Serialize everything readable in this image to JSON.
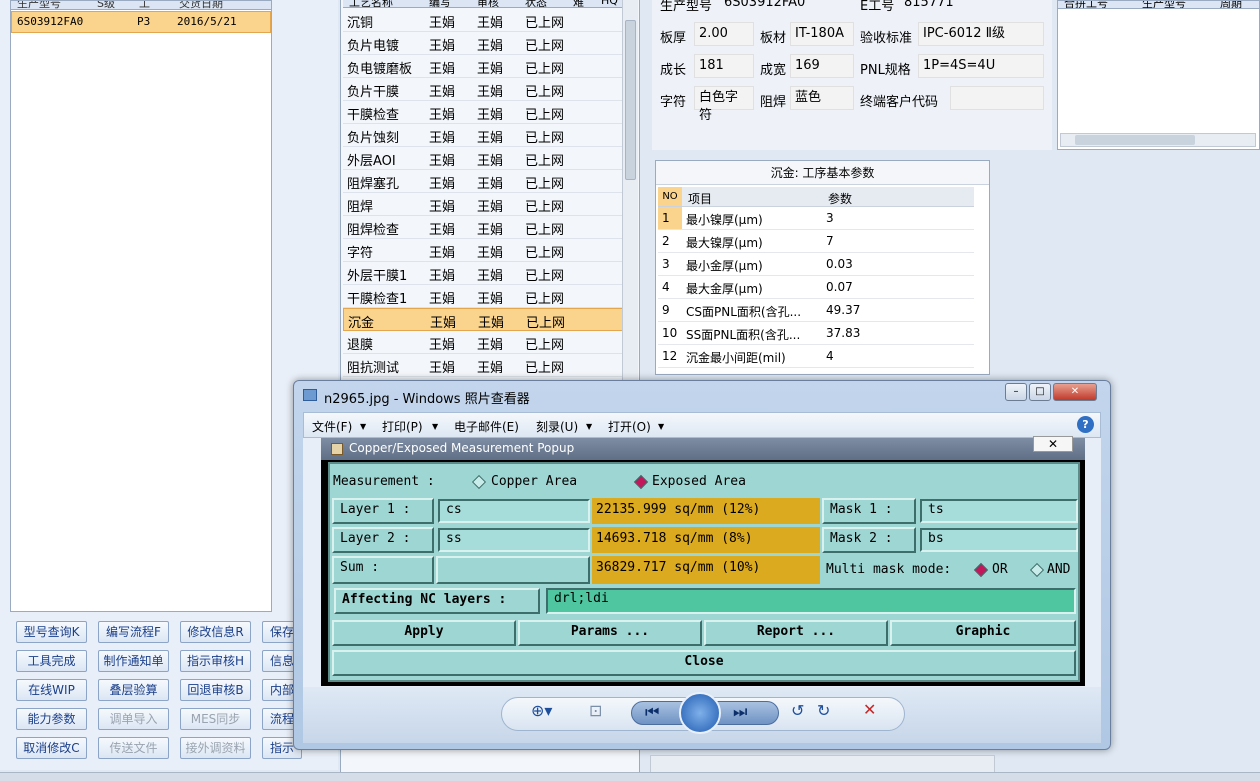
{
  "left": {
    "headers": [
      "生产型号",
      "S级",
      "工",
      "交货日期"
    ],
    "row": {
      "model": "6S03912FA0",
      "grade": "P3",
      "date": "2016/5/21"
    },
    "buttons": [
      [
        "型号查询K",
        "编写流程F",
        "修改信息R",
        "保存"
      ],
      [
        "工具完成",
        "制作通知单",
        "指示审核H",
        "信息"
      ],
      [
        "在线WIP",
        "叠层验算",
        "回退审核B",
        "内部"
      ],
      [
        "能力参数",
        "调单导入",
        "MES同步",
        "流程"
      ],
      [
        "取消修改C",
        "传送文件",
        "接外调资料",
        "指示"
      ]
    ]
  },
  "mid": {
    "headers": [
      "工艺名称",
      "编写",
      "审核",
      "状态",
      "难",
      "HQ"
    ],
    "rows": [
      {
        "name": "沉铜",
        "w": "王娟",
        "a": "王娟",
        "s": "已上网"
      },
      {
        "name": "负片电镀",
        "w": "王娟",
        "a": "王娟",
        "s": "已上网"
      },
      {
        "name": "负电镀磨板",
        "w": "王娟",
        "a": "王娟",
        "s": "已上网"
      },
      {
        "name": "负片干膜",
        "w": "王娟",
        "a": "王娟",
        "s": "已上网"
      },
      {
        "name": "干膜检查",
        "w": "王娟",
        "a": "王娟",
        "s": "已上网"
      },
      {
        "name": "负片蚀刻",
        "w": "王娟",
        "a": "王娟",
        "s": "已上网"
      },
      {
        "name": "外层AOI",
        "w": "王娟",
        "a": "王娟",
        "s": "已上网"
      },
      {
        "name": "阻焊塞孔",
        "w": "王娟",
        "a": "王娟",
        "s": "已上网"
      },
      {
        "name": "阻焊",
        "w": "王娟",
        "a": "王娟",
        "s": "已上网"
      },
      {
        "name": "阻焊检查",
        "w": "王娟",
        "a": "王娟",
        "s": "已上网"
      },
      {
        "name": "字符",
        "w": "王娟",
        "a": "王娟",
        "s": "已上网"
      },
      {
        "name": "外层干膜1",
        "w": "王娟",
        "a": "王娟",
        "s": "已上网"
      },
      {
        "name": "干膜检查1",
        "w": "王娟",
        "a": "王娟",
        "s": "已上网"
      },
      {
        "name": "沉金",
        "w": "王娟",
        "a": "王娟",
        "s": "已上网"
      },
      {
        "name": "退膜",
        "w": "王娟",
        "a": "王娟",
        "s": "已上网"
      },
      {
        "name": "阻抗测试",
        "w": "王娟",
        "a": "王娟",
        "s": "已上网"
      }
    ]
  },
  "info": {
    "model_label": "生产型号",
    "model_val": "6S03912FA0",
    "eno_label": "E工号",
    "eno_val": "815771",
    "thick_label": "板厚",
    "thick_val": "2.00",
    "mat_label": "板材",
    "mat_val": "IT-180A",
    "std_label": "验收标准",
    "std_val": "IPC-6012 Ⅱ级",
    "len_label": "成长",
    "len_val": "181",
    "wid_label": "成宽",
    "wid_val": "169",
    "pnl_label": "PNL规格",
    "pnl_val": "1P=4S=4U",
    "char_label": "字符",
    "char_val": "白色字符",
    "mask_label": "阻焊",
    "mask_val": "蓝色",
    "cust_label": "终端客户代码",
    "cust_val": ""
  },
  "rightlist": {
    "headers": [
      "合拼工号",
      "生产型号",
      "周期"
    ]
  },
  "param": {
    "title": "沉金: 工序基本参数",
    "headers": [
      "NO",
      "项目",
      "参数"
    ],
    "rows": [
      {
        "no": "1",
        "item": "最小镍厚(μm)",
        "val": "3"
      },
      {
        "no": "2",
        "item": "最大镍厚(μm)",
        "val": "7"
      },
      {
        "no": "3",
        "item": "最小金厚(μm)",
        "val": "0.03"
      },
      {
        "no": "4",
        "item": "最大金厚(μm)",
        "val": "0.07"
      },
      {
        "no": "9",
        "item": "CS面PNL面积(含孔...",
        "val": "49.37"
      },
      {
        "no": "10",
        "item": "SS面PNL面积(含孔...",
        "val": "37.83"
      },
      {
        "no": "12",
        "item": "沉金最小间距(mil)",
        "val": "4"
      }
    ]
  },
  "viewer": {
    "title": "n2965.jpg - Windows 照片查看器",
    "menu": [
      "文件(F)",
      "打印(P)",
      "电子邮件(E)",
      "刻录(U)",
      "打开(O)"
    ],
    "help": "?"
  },
  "dialog": {
    "title": "Copper/Exposed Measurement Popup",
    "measurement_label": "Measurement  :",
    "opt_copper": "Copper Area",
    "opt_exposed": "Exposed Area",
    "layer1_label": "Layer 1 :",
    "layer1_val": "cs",
    "layer1_result": "22135.999 sq/mm (12%)",
    "mask1_label": "Mask 1 :",
    "mask1_val": "ts",
    "layer2_label": "Layer 2 :",
    "layer2_val": "ss",
    "layer2_result": "14693.718 sq/mm (8%)",
    "mask2_label": "Mask 2 :",
    "mask2_val": "bs",
    "sum_label": "Sum     :",
    "sum_result": "36829.717 sq/mm (10%)",
    "multi_label": "Multi mask mode:",
    "opt_or": "OR",
    "opt_and": "AND",
    "nc_label": "Affecting NC layers :",
    "nc_val": "drl;ldi",
    "apply": "Apply",
    "params": "Params ...",
    "report": "Report ...",
    "graphic": "Graphic",
    "close": "Close"
  }
}
